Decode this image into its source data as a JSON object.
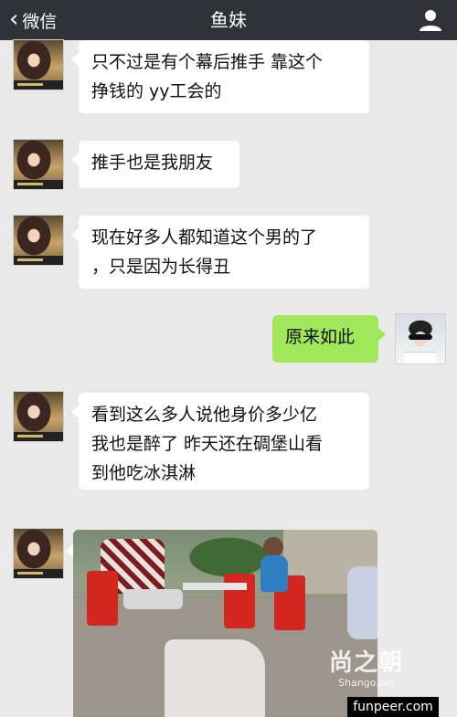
{
  "header": {
    "back_label": "微信",
    "title": "鱼妹",
    "icons": {
      "back": "chevron-left-icon",
      "contact": "person-icon"
    }
  },
  "messages": [
    {
      "side": "in",
      "lines": [
        "只不过是有个幕后推手 靠这个",
        "挣钱的 yy工会的"
      ]
    },
    {
      "side": "in",
      "lines": [
        "推手也是我朋友"
      ]
    },
    {
      "side": "in",
      "lines": [
        "现在好多人都知道这个男的了",
        "，只是因为长得丑"
      ]
    },
    {
      "side": "out",
      "lines": [
        "原来如此"
      ]
    },
    {
      "side": "in",
      "lines": [
        "看到这么多人说他身价多少亿",
        "我也是醉了 昨天还在碉堡山看",
        "到他吃冰淇淋"
      ]
    }
  ],
  "watermark": {
    "logo": "尚之朝",
    "sub": "Shango.net",
    "site": "funpeer.com"
  },
  "colors": {
    "topbar": "#2f3236",
    "background": "#e9e9e9",
    "outgoing_bubble": "#a0e75a",
    "incoming_bubble": "#ffffff"
  }
}
